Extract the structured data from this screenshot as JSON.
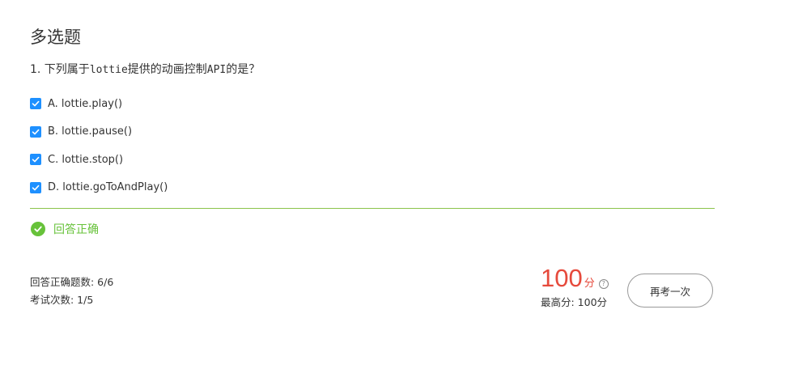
{
  "section_title": "多选题",
  "question": {
    "prefix": "1. 下列属于",
    "code": "lottie",
    "middle": "提供的动画控制",
    "api": "API",
    "suffix": "的是？"
  },
  "options": [
    {
      "label": "A. lottie.play()",
      "checked": true
    },
    {
      "label": "B. lottie.pause()",
      "checked": true
    },
    {
      "label": "C. lottie.stop()",
      "checked": true
    },
    {
      "label": "D. lottie.goToAndPlay()",
      "checked": true
    }
  ],
  "result": {
    "text": "回答正确",
    "icon": "check-circle-icon",
    "color": "#67c23a"
  },
  "stats": {
    "correct_count": "回答正确题数: 6/6",
    "attempts": "考试次数: 1/5"
  },
  "score": {
    "value": "100",
    "unit": "分",
    "help_icon": "question-circle-icon",
    "best": "最高分:  100分",
    "color": "#e64a3c"
  },
  "retry_label": "再考一次",
  "colors": {
    "accent": "#1e90ff",
    "success": "#67c23a",
    "divider": "#8bc34a"
  }
}
